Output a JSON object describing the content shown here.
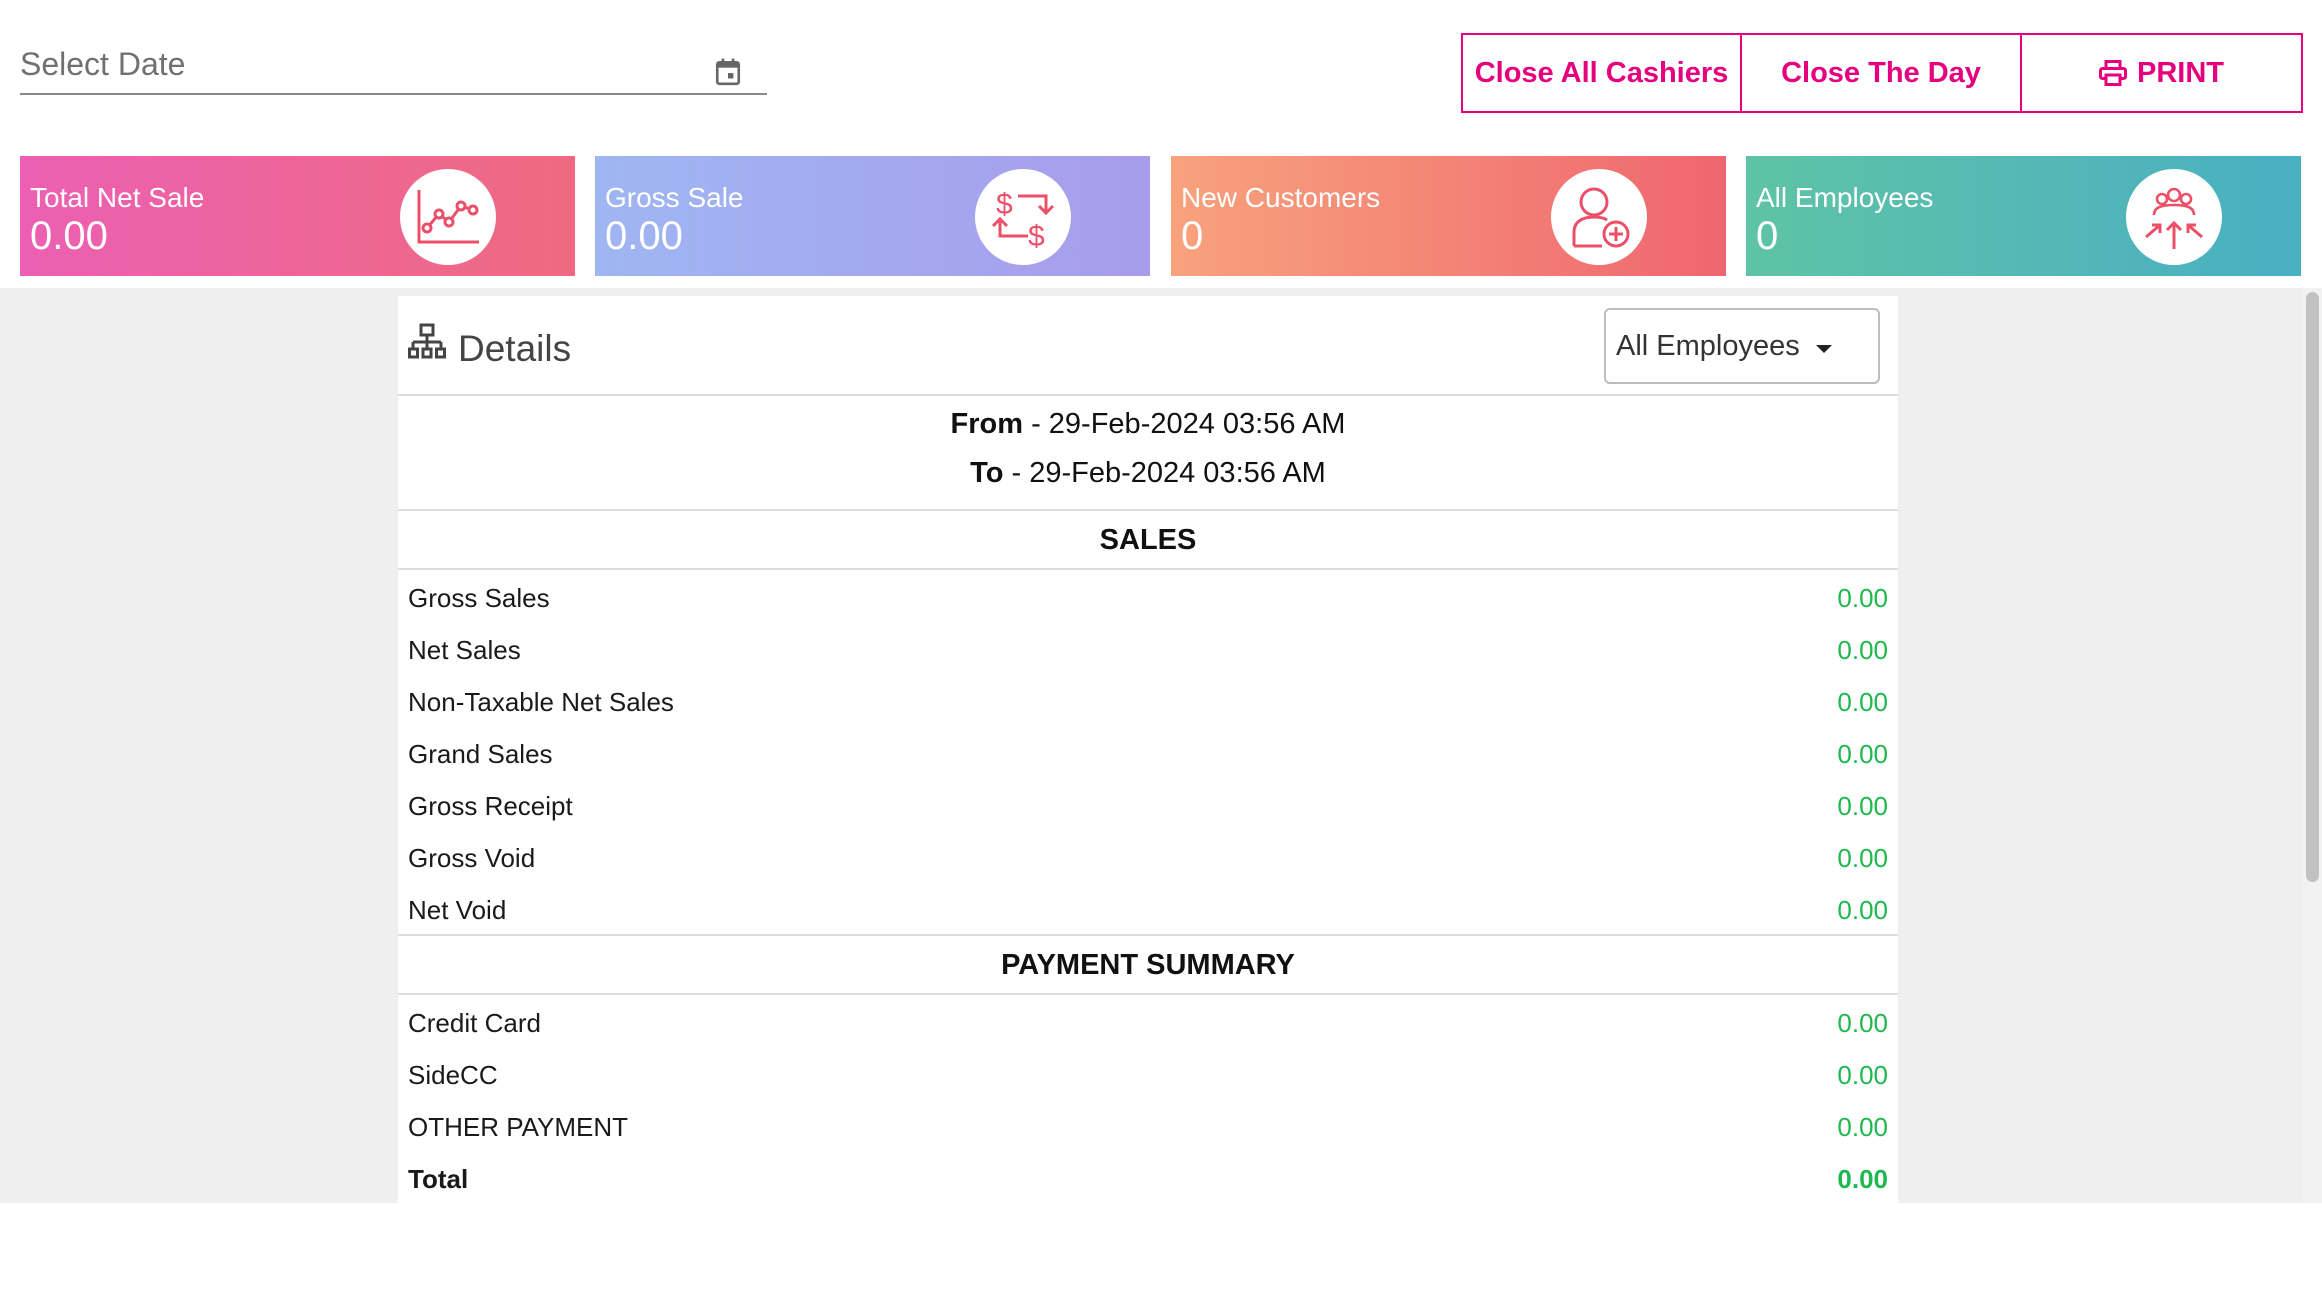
{
  "date_picker": {
    "placeholder": "Select Date",
    "icon": "calendar-icon"
  },
  "actions": {
    "close_cashiers": "Close All Cashiers",
    "close_day": "Close The Day",
    "print": "PRINT",
    "accent_color": "#e6007e"
  },
  "cards": [
    {
      "label": "Total Net Sale",
      "value": "0.00",
      "icon": "line-chart-icon"
    },
    {
      "label": "Gross Sale",
      "value": "0.00",
      "icon": "dollar-exchange-icon"
    },
    {
      "label": "New Customers",
      "value": "0",
      "icon": "add-user-icon"
    },
    {
      "label": "All Employees",
      "value": "0",
      "icon": "group-icon"
    }
  ],
  "details": {
    "title": "Details",
    "employee_filter": "All Employees",
    "from_label": "From",
    "from_value": " - 29-Feb-2024 03:56 AM",
    "to_label": "To",
    "to_value": " - 29-Feb-2024 03:56 AM",
    "sales": {
      "title": "SALES",
      "rows": [
        {
          "name": "Gross Sales",
          "amount": "0.00"
        },
        {
          "name": "Net Sales",
          "amount": "0.00"
        },
        {
          "name": "Non-Taxable Net Sales",
          "amount": "0.00"
        },
        {
          "name": "Grand Sales",
          "amount": "0.00"
        },
        {
          "name": "Gross Receipt",
          "amount": "0.00"
        },
        {
          "name": "Gross Void",
          "amount": "0.00"
        },
        {
          "name": "Net Void",
          "amount": "0.00"
        }
      ]
    },
    "payment_summary": {
      "title": "PAYMENT SUMMARY",
      "rows": [
        {
          "name": "Credit Card",
          "amount": "0.00"
        },
        {
          "name": "SideCC",
          "amount": "0.00"
        },
        {
          "name": "OTHER PAYMENT",
          "amount": "0.00"
        },
        {
          "name": "Total",
          "amount": "0.00"
        }
      ]
    },
    "amount_color": "#1fb84f"
  }
}
